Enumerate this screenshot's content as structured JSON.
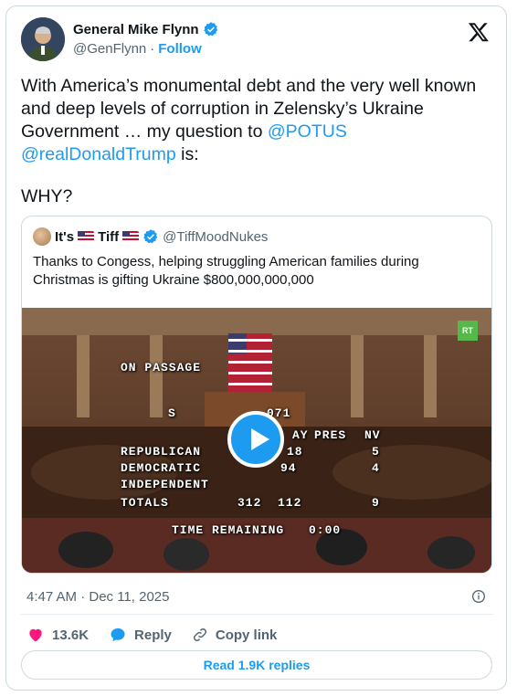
{
  "author": {
    "name": "General Mike Flynn",
    "handle": "@GenFlynn",
    "separator": "·",
    "follow_label": "Follow"
  },
  "tweet": {
    "text_part1": "With America’s monumental debt and the very well known and deep levels of corruption in Zelensky’s Ukraine Government … my question to ",
    "mention1": "@POTUS",
    "mention2": "@realDonaldTrump",
    "text_part2": " is:",
    "why": "WHY?"
  },
  "quote": {
    "name_prefix": "It's",
    "name_suffix": "Tiff",
    "handle": "@TiffMoodNukes",
    "text": "Thanks to Congess, helping struggling American families during Christmas is gifting Ukraine $800,000,000,000"
  },
  "video_overlay": {
    "on_passage": "ON PASSAGE",
    "col_s": "S",
    "col_071": "071",
    "col_ay": "AY",
    "col_pres": "PRES",
    "col_nv": "NV",
    "republican": "REPUBLICAN",
    "democratic": "DEMOCRATIC",
    "independent": "INDEPENDENT",
    "totals": "TOTALS",
    "rep_vals": "18",
    "rep_nv": "5",
    "dem_vals": "94",
    "dem_nv": "4",
    "totals_yea": "312",
    "totals_nay": "112",
    "totals_nv": "9",
    "time_remaining": "TIME REMAINING",
    "time_value": "0:00",
    "badge": "RT"
  },
  "footer": {
    "timestamp": "4:47 AM · Dec 11, 2025",
    "likes": "13.6K",
    "reply_label": "Reply",
    "copy_link_label": "Copy link",
    "read_replies": "Read 1.9K replies"
  },
  "colors": {
    "accent": "#1d9bf0",
    "like": "#f91880",
    "text": "#0f1419",
    "secondary": "#536471"
  }
}
